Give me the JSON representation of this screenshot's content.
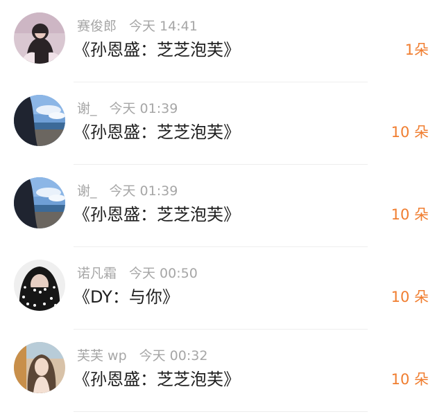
{
  "records": [
    {
      "user": "赛俊郎",
      "time": "今天 14:41",
      "message": "《孙恩盛：芝芝泡芙》",
      "gift": "1朵",
      "avatar_icon": "avatar-girl-pink"
    },
    {
      "user": "谢_",
      "time": "今天 01:39",
      "message": "《孙恩盛：芝芝泡芙》",
      "gift": "10 朵",
      "avatar_icon": "avatar-beach-sky"
    },
    {
      "user": "谢_",
      "time": "今天 01:39",
      "message": "《孙恩盛：芝芝泡芙》",
      "gift": "10 朵",
      "avatar_icon": "avatar-beach-sky"
    },
    {
      "user": "诺凡霜",
      "time": "今天 00:50",
      "message": "《DY：与你》",
      "gift": "10 朵",
      "avatar_icon": "avatar-polka-hood"
    },
    {
      "user": "芙芙 wp",
      "time": "今天 00:32",
      "message": "《孙恩盛：芝芝泡芙》",
      "gift": "10 朵",
      "avatar_icon": "avatar-girl-car"
    }
  ],
  "colors": {
    "gift_accent": "#f07d2f",
    "meta_gray": "#a6a6a6",
    "message_text": "#1f1f1f",
    "divider": "#eeeeee"
  }
}
